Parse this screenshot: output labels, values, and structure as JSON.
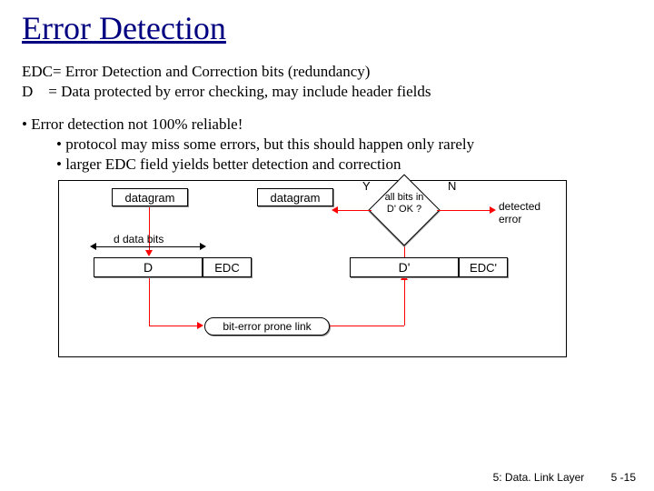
{
  "title": "Error Detection",
  "def1": "EDC= Error Detection and Correction bits (redundancy)",
  "def2": "D    = Data protected by error checking, may include header fields",
  "b1": "• Error detection not 100% reliable!",
  "b1a": "• protocol may miss some errors, but this should happen only rarely",
  "b1b": "• larger EDC field yields better detection and correction",
  "diagram": {
    "datagram_l": "datagram",
    "datagram_r": "datagram",
    "d_label": "D",
    "edc_label": "EDC",
    "dp_label": "D'",
    "edcp_label": "EDC'",
    "dbits": "d data bits",
    "link": "bit-error prone link",
    "diamond": "all bits in D' OK ?",
    "y": "Y",
    "n": "N",
    "err": "detected error"
  },
  "footer": {
    "chapter": "5: Data. Link Layer",
    "page": "5 -15"
  }
}
